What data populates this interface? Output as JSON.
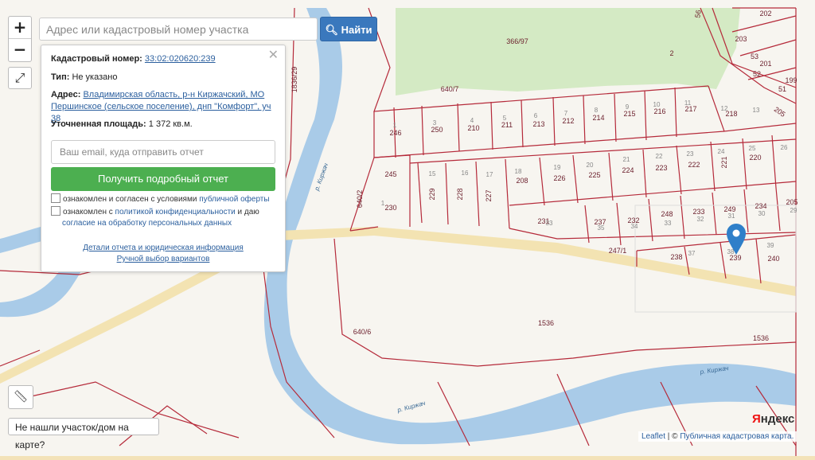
{
  "search": {
    "placeholder": "Адрес или кадастровый номер участка",
    "button": "Найти"
  },
  "zoom": {
    "in": "+",
    "out": "−"
  },
  "panel": {
    "cadastral_label": "Кадастровый номер:",
    "cadastral_value": "33:02:020620:239",
    "type_label": "Тип:",
    "type_value": "Не указано",
    "address_label": "Адрес:",
    "address_value_1": "Владимирская область, р-н Киржачский, МО",
    "address_value_2": "Першинское (сельское поселение), днп \"Комфорт\", уч 38",
    "area_label": "Уточненная площадь:",
    "area_value": "1 372 кв.м.",
    "email_placeholder": "Ваш email, куда отправить отчет",
    "report_button": "Получить подробный отчет",
    "consent1_text": "ознакомлен и согласен с условиями",
    "consent1_link": "публичной оферты",
    "consent2_text": "ознакомлен с",
    "consent2_link": "политикой конфиденциальности",
    "consent2_and": "и даю",
    "consent2_link2": "согласие на обработку персональных данных",
    "details_link": "Детали отчета и юридическая информация",
    "manual_link": "Ручной выбор вариантов"
  },
  "not_found": "Не нашли участок/дом на карте?",
  "logo": {
    "first": "Я",
    "rest": "ндекс"
  },
  "attribution": {
    "leaflet": "Leaflet",
    "sep": " | © ",
    "pkk": "Публичная кадастровая карта."
  },
  "map_labels": {
    "parcels": [
      {
        "t": "366/97"
      },
      {
        "t": "2"
      },
      {
        "t": "202"
      },
      {
        "t": "203"
      },
      {
        "t": "201"
      },
      {
        "t": "199"
      },
      {
        "t": "56"
      },
      {
        "t": "53"
      },
      {
        "t": "52"
      },
      {
        "t": "51"
      },
      {
        "t": "205"
      },
      {
        "t": "640/7"
      },
      {
        "t": "1836/29"
      },
      {
        "t": "246"
      },
      {
        "t": "250"
      },
      {
        "t": "210"
      },
      {
        "t": "211"
      },
      {
        "t": "213"
      },
      {
        "t": "212"
      },
      {
        "t": "214"
      },
      {
        "t": "215"
      },
      {
        "t": "216"
      },
      {
        "t": "217"
      },
      {
        "t": "218"
      },
      {
        "t": "245"
      },
      {
        "t": "229"
      },
      {
        "t": "228"
      },
      {
        "t": "227"
      },
      {
        "t": "208"
      },
      {
        "t": "226"
      },
      {
        "t": "225"
      },
      {
        "t": "224"
      },
      {
        "t": "223"
      },
      {
        "t": "222"
      },
      {
        "t": "221"
      },
      {
        "t": "220"
      },
      {
        "t": "230"
      },
      {
        "t": "640/2"
      },
      {
        "t": "231"
      },
      {
        "t": "237"
      },
      {
        "t": "232"
      },
      {
        "t": "248"
      },
      {
        "t": "233"
      },
      {
        "t": "249"
      },
      {
        "t": "234"
      },
      {
        "t": "205"
      },
      {
        "t": "247/1"
      },
      {
        "t": "238"
      },
      {
        "t": "239"
      },
      {
        "t": "240"
      },
      {
        "t": "1536"
      },
      {
        "t": "1536"
      },
      {
        "t": "640/6"
      }
    ],
    "small_nums": [
      "1",
      "3",
      "4",
      "5",
      "6",
      "7",
      "8",
      "9",
      "10",
      "11",
      "12",
      "13",
      "15",
      "16",
      "17",
      "18",
      "19",
      "20",
      "21",
      "22",
      "23",
      "24",
      "25",
      "26",
      "1",
      "33",
      "35",
      "34",
      "33",
      "32",
      "31",
      "30",
      "29",
      "37",
      "38",
      "39"
    ],
    "rivers": [
      "р. Киржач",
      "р. Киржач",
      "р. Киржач"
    ]
  }
}
